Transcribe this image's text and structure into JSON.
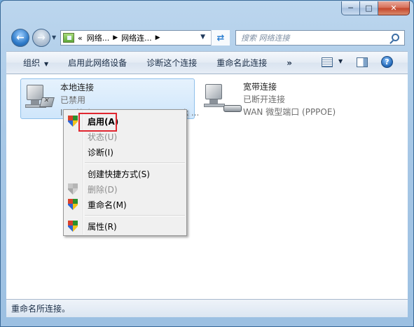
{
  "window": {
    "caption_buttons": {
      "minimize_icon": "minimize-icon",
      "maximize_icon": "maximize-icon",
      "close_icon": "close-icon"
    }
  },
  "address_bar": {
    "overflow": "«",
    "crumbs": [
      "网络...",
      "网络连..."
    ],
    "search_placeholder": "搜索 网络连接"
  },
  "command_bar": {
    "organize": "组织",
    "enable_device": "启用此网络设备",
    "diagnose": "诊断这个连接",
    "rename": "重命名此连接",
    "more": "»"
  },
  "connections": [
    {
      "name": "本地连接",
      "status": "已禁用",
      "device": "Intel(R) PRO/1000 MT Network ..."
    },
    {
      "name": "宽带连接",
      "status": "已断开连接",
      "device": "WAN 微型端口 (PPPOE)"
    }
  ],
  "context_menu": {
    "items": [
      {
        "label": "启用(A)",
        "icon": "shield-icon",
        "disabled": false,
        "default": true
      },
      {
        "label": "状态(U)",
        "icon": "",
        "disabled": true
      },
      {
        "label": "诊断(I)",
        "icon": "",
        "disabled": false
      },
      {
        "label": "创建快捷方式(S)",
        "icon": "",
        "disabled": false
      },
      {
        "label": "删除(D)",
        "icon": "shield-icon",
        "disabled": true
      },
      {
        "label": "重命名(M)",
        "icon": "shield-icon",
        "disabled": false
      },
      {
        "label": "属性(R)",
        "icon": "shield-icon",
        "disabled": false
      }
    ]
  },
  "status_bar": {
    "text": "重命名所连接。"
  },
  "colors": {
    "highlight": "#e0262f",
    "selection": "#cfe6fb"
  }
}
